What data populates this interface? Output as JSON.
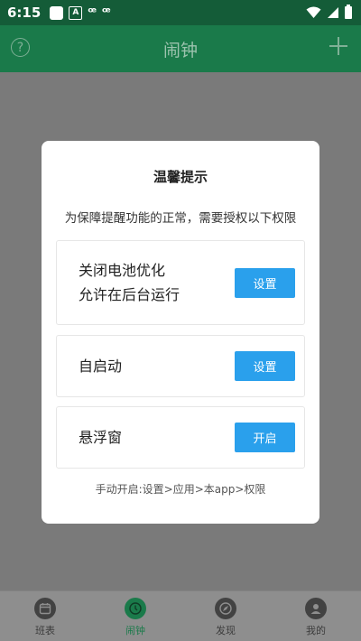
{
  "status_bar": {
    "time": "6:15",
    "left_icons": [
      "square-icon",
      "a-icon",
      "bug-icon",
      "bug-icon"
    ],
    "bug_glyph": "ꟹ",
    "right_icons": [
      "wifi-icon",
      "signal-icon",
      "battery-icon"
    ]
  },
  "app_bar": {
    "title": "闹钟",
    "help_glyph": "?",
    "left_icon": "help-icon",
    "right_icon": "plus-icon"
  },
  "dialog": {
    "title": "温馨提示",
    "message": "为保障提醒功能的正常，需要授权以下权限",
    "items": [
      {
        "line1": "关闭电池优化",
        "line2": "允许在后台运行",
        "button": "设置"
      },
      {
        "line1": "自启动",
        "button": "设置"
      },
      {
        "line1": "悬浮窗",
        "button": "开启"
      }
    ],
    "footer": "手动开启:设置>应用>本app>权限"
  },
  "tabs": [
    {
      "label": "班表",
      "icon": "calendar-icon",
      "active": false
    },
    {
      "label": "闹钟",
      "icon": "clock-icon",
      "active": true
    },
    {
      "label": "发现",
      "icon": "compass-icon",
      "active": false
    },
    {
      "label": "我的",
      "icon": "user-icon",
      "active": false
    }
  ],
  "colors": {
    "status_bar": "#145c38",
    "app_bar": "#1a7a4a",
    "button": "#2aa0ec",
    "overlay": "#7a7a7a",
    "active_tab": "#1a7a4a"
  }
}
